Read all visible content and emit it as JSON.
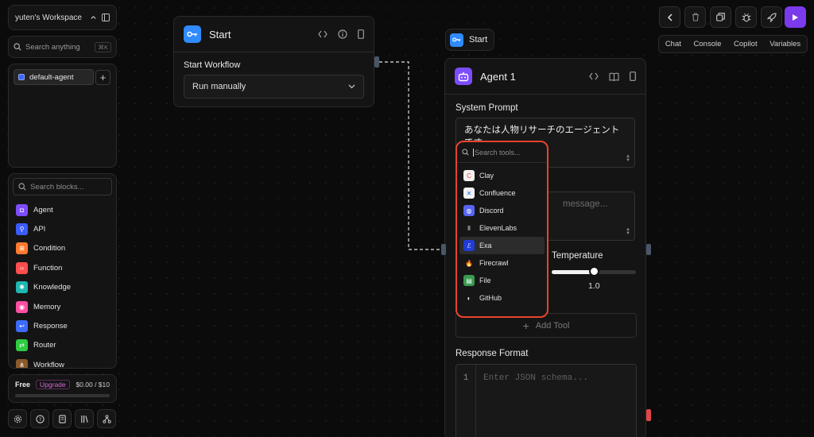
{
  "workspace": {
    "name": "yuten's Workspace"
  },
  "sidebar": {
    "search_anything": {
      "placeholder": "Search anything",
      "shortcut": "⌘K"
    },
    "agents": [
      {
        "label": "default-agent",
        "color": "#3f63ff"
      }
    ],
    "search_blocks": {
      "placeholder": "Search blocks..."
    },
    "blocks": [
      {
        "label": "Agent",
        "icon": "bot-icon",
        "color": "#7c4dff"
      },
      {
        "label": "API",
        "icon": "api-icon",
        "color": "#3b5bff"
      },
      {
        "label": "Condition",
        "icon": "condition-icon",
        "color": "#ff7a2f"
      },
      {
        "label": "Function",
        "icon": "function-icon",
        "color": "#ff4d4d"
      },
      {
        "label": "Knowledge",
        "icon": "knowledge-icon",
        "color": "#1fb6b0"
      },
      {
        "label": "Memory",
        "icon": "memory-icon",
        "color": "#ff4fa3"
      },
      {
        "label": "Response",
        "icon": "response-icon",
        "color": "#3e6bff"
      },
      {
        "label": "Router",
        "icon": "router-icon",
        "color": "#2ecc40"
      },
      {
        "label": "Workflow",
        "icon": "workflow-icon",
        "color": "#8a5a2b"
      }
    ],
    "plan": {
      "tier": "Free",
      "upgrade_label": "Upgrade",
      "usage": "$0.00 / $10",
      "usage_fraction": 0.0
    },
    "bottom_icons": [
      "settings-icon",
      "help-icon",
      "docs-icon",
      "library-icon",
      "network-icon"
    ]
  },
  "nodes": {
    "start": {
      "title": "Start",
      "field_label": "Start Workflow",
      "trigger_value": "Run manually"
    },
    "start_tag": {
      "title": "Start"
    },
    "agent": {
      "title": "Agent 1",
      "system_prompt_label": "System Prompt",
      "system_prompt_value": "あなたは人物リサーチのエージェントです。",
      "user_message_placeholder": "message...",
      "temperature_label": "Temperature",
      "temperature_value": "1.0",
      "temperature_fraction": 0.5,
      "add_tool_label": "Add Tool",
      "response_format_label": "Response Format",
      "json_line_number": "1",
      "json_placeholder": "Enter JSON schema..."
    }
  },
  "tools_dropdown": {
    "search_placeholder": "Search tools...",
    "items": [
      {
        "label": "Clay",
        "icon": "clay-icon",
        "color": "#f2f2f2"
      },
      {
        "label": "Confluence",
        "icon": "confluence-icon",
        "color": "#f2f2f2"
      },
      {
        "label": "Discord",
        "icon": "discord-icon",
        "color": "#5865f2"
      },
      {
        "label": "ElevenLabs",
        "icon": "elevenlabs-icon",
        "color": "#161616"
      },
      {
        "label": "Exa",
        "icon": "exa-icon",
        "color": "#1f3cd6"
      },
      {
        "label": "Firecrawl",
        "icon": "firecrawl-icon",
        "color": "#161616"
      },
      {
        "label": "File",
        "icon": "file-icon",
        "color": "#3b9a52"
      },
      {
        "label": "GitHub",
        "icon": "github-icon",
        "color": "#161616"
      }
    ],
    "active_index": 4
  },
  "toolbar": {
    "tabs": [
      "Chat",
      "Console",
      "Copilot",
      "Variables"
    ]
  },
  "colors": {
    "accent": "#7c3aed",
    "highlight": "#e8442c",
    "start": "#2f8bff"
  }
}
